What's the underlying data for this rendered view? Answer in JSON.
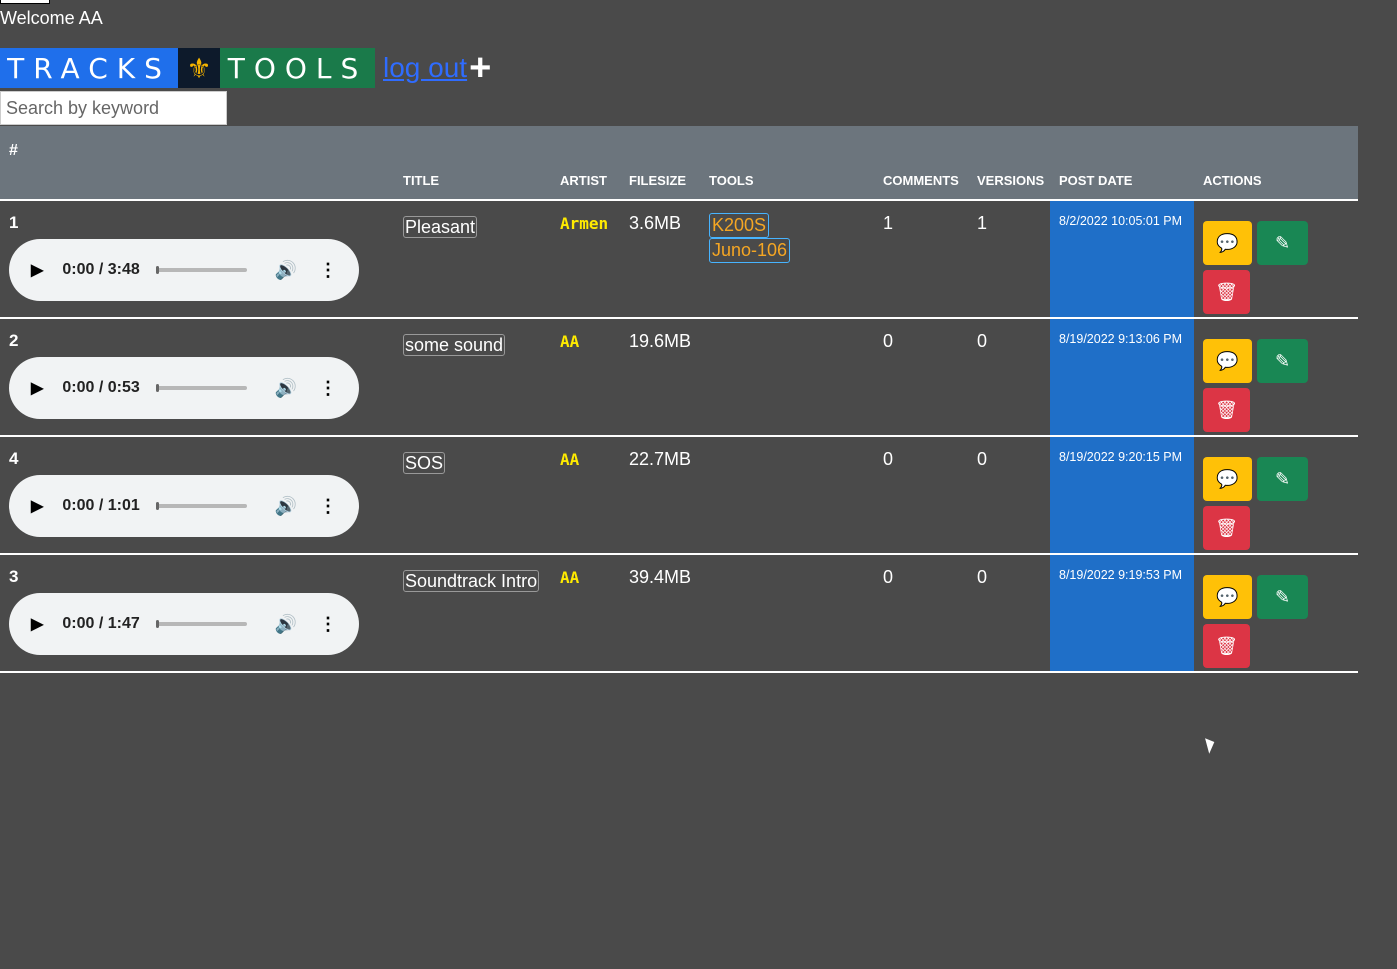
{
  "header": {
    "welcome": "Welcome AA",
    "brand_left": "TRACKS",
    "brand_logo": "⚜",
    "brand_right": "TOOLS",
    "logout": "log out",
    "add_icon": "+"
  },
  "search": {
    "placeholder": "Search by keyword",
    "value": ""
  },
  "table": {
    "columns": [
      "#",
      "TITLE",
      "ARTIST",
      "FILESIZE",
      "TOOLS",
      "COMMENTS",
      "VERSIONS",
      "POST DATE",
      "ACTIONS"
    ],
    "rows": [
      {
        "num": "1",
        "time": "0:00 / 3:48",
        "title": "Pleasant",
        "artist": "Armen",
        "filesize": "3.6MB",
        "tools": [
          "K200S",
          "Juno-106"
        ],
        "comments": "1",
        "versions": "1",
        "post_date": "8/2/2022 10:05:01 PM"
      },
      {
        "num": "2",
        "time": "0:00 / 0:53",
        "title": "some sound",
        "artist": "AA",
        "filesize": "19.6MB",
        "tools": [],
        "comments": "0",
        "versions": "0",
        "post_date": "8/19/2022 9:13:06 PM"
      },
      {
        "num": "4",
        "time": "0:00 / 1:01",
        "title": "SOS",
        "artist": "AA",
        "filesize": "22.7MB",
        "tools": [],
        "comments": "0",
        "versions": "0",
        "post_date": "8/19/2022 9:20:15 PM"
      },
      {
        "num": "3",
        "time": "0:00 / 1:47",
        "title": "Soundtrack Intro",
        "artist": "AA",
        "filesize": "39.4MB",
        "tools": [],
        "comments": "0",
        "versions": "0",
        "post_date": "8/19/2022 9:19:53 PM"
      }
    ]
  },
  "icons": {
    "play": "play-icon",
    "volume": "volume-icon",
    "more": "more-vertical-icon",
    "comment": "comment-icon",
    "edit": "edit-icon",
    "delete": "trash-icon"
  },
  "colors": {
    "background": "#4a4a4a",
    "header_bg": "#6c757d",
    "brand_blue": "#1f6feb",
    "brand_green": "#1a7a4a",
    "date_bg": "#1f6fc8",
    "comment_btn": "#ffc107",
    "edit_btn": "#198754",
    "delete_btn": "#dc3545",
    "artist": "#ffeb00"
  }
}
